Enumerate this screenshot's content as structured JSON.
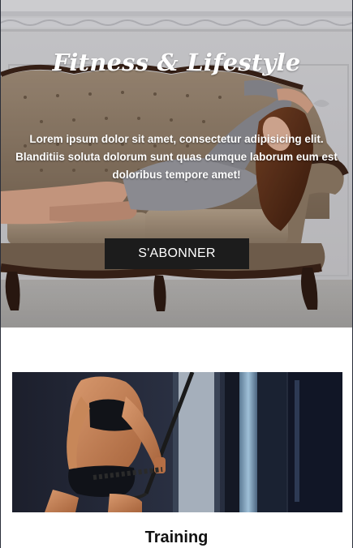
{
  "hero": {
    "title": "Fitness & Lifestyle",
    "text": "Lorem ipsum dolor sit amet, consectetur adipisicing elit. Blanditiis soluta dolorum sunt quas cumque laborum eum est doloribus tempore amet!",
    "button_label": "S'ABONNER"
  },
  "card": {
    "title": "Training"
  }
}
